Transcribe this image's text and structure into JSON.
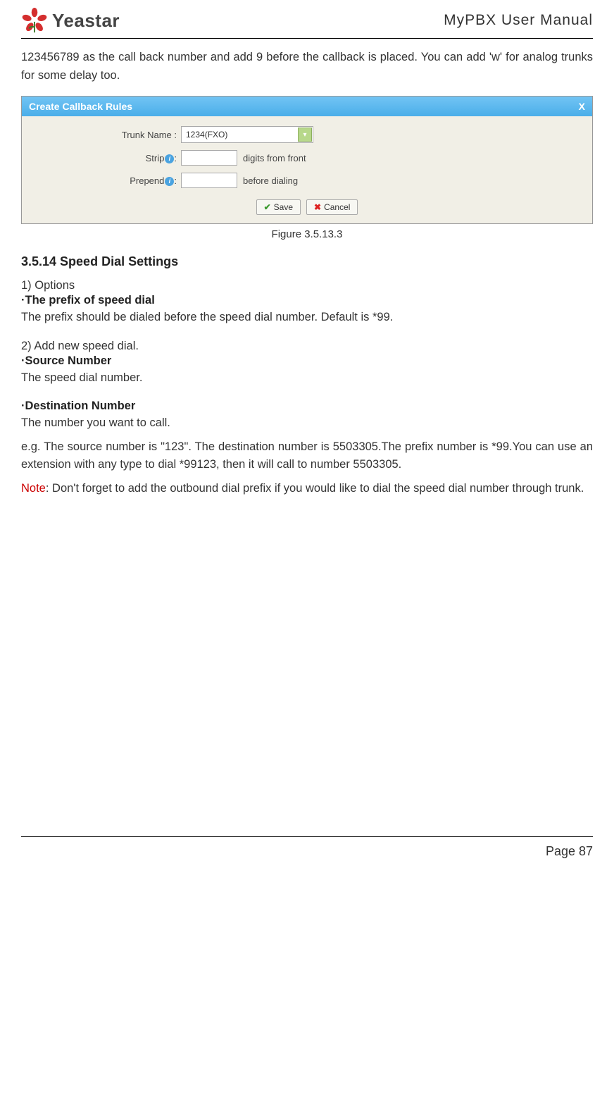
{
  "header": {
    "brand": "Yeastar",
    "doc_title": "MyPBX User Manual"
  },
  "intro_text": "123456789 as the call back number and add 9 before the callback is placed. You can add 'w' for analog trunks for some delay too.",
  "figure": {
    "title": "Create Callback Rules",
    "close": "X",
    "rows": {
      "trunk_label": "Trunk Name :",
      "trunk_value": "1234(FXO)",
      "strip_label": "Strip",
      "strip_colon": ":",
      "strip_after": "digits from front",
      "prepend_label": "Prepend",
      "prepend_colon": ":",
      "prepend_after": "before dialing"
    },
    "buttons": {
      "save": "Save",
      "cancel": "Cancel"
    },
    "caption": "Figure 3.5.13.3"
  },
  "section": {
    "heading": "3.5.14 Speed Dial Settings",
    "options_title": "1) Options",
    "prefix_bold": "·The prefix of speed dial",
    "prefix_text": "The prefix should be dialed before the speed dial number. Default is *99.",
    "add_title": "2) Add new speed dial.",
    "source_bold": "·Source Number",
    "source_text": "The speed dial number.",
    "dest_bold": "·Destination Number",
    "dest_text": "The number you want to call.",
    "example_text": "e.g. The source number is \"123\". The destination number is 5503305.The prefix number is *99.You can use an extension with any type to dial *99123, then it will call to number 5503305.",
    "note_label": "Note",
    "note_text": ": Don't forget to add the outbound dial prefix if you would like to dial the speed dial number through trunk."
  },
  "footer": {
    "page": "Page 87"
  }
}
